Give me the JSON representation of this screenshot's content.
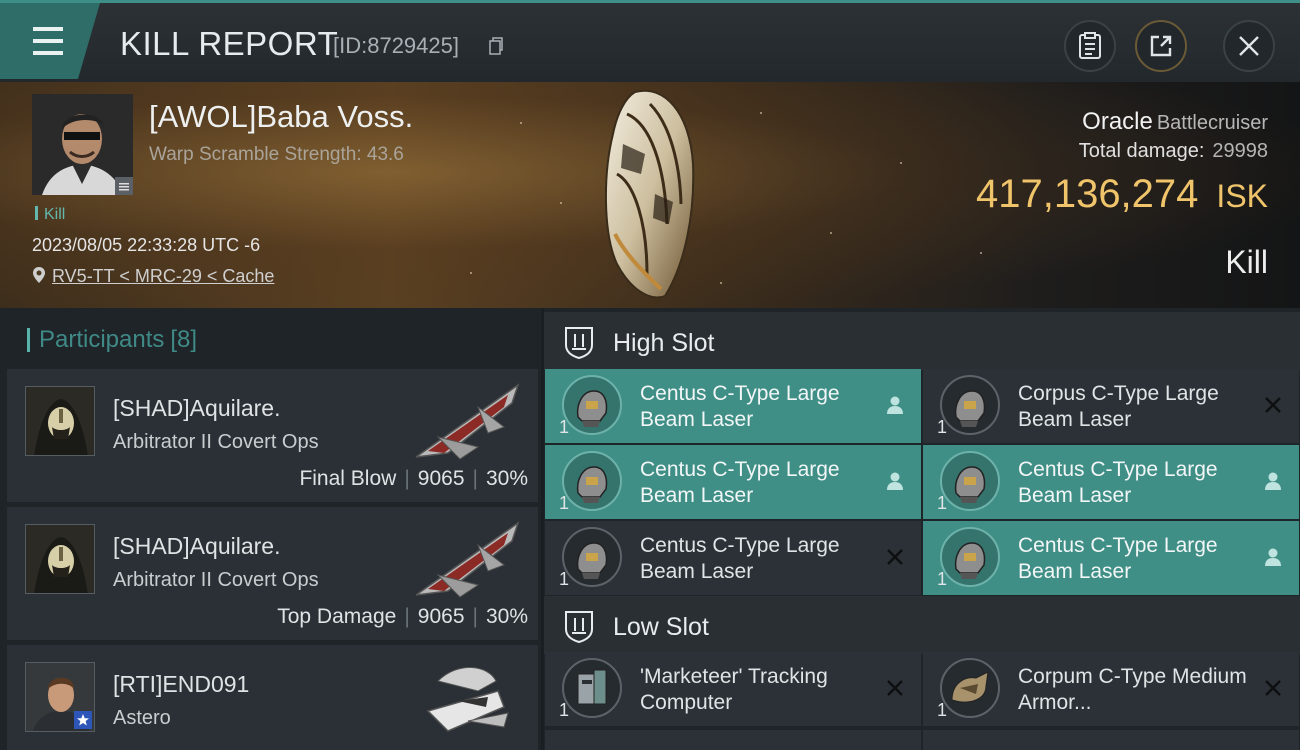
{
  "header": {
    "title": "KILL REPORT",
    "report_id": "[ID:8729425]"
  },
  "victim": {
    "name": "[AWOL]Baba Voss.",
    "warp_scramble": "Warp Scramble Strength: 43.6",
    "kill_tag": "Kill",
    "timestamp": "2023/08/05 22:33:28 UTC -6",
    "location": "RV5-TT < MRC-29 < Cache"
  },
  "ship": {
    "name": "Oracle",
    "class": "Battlecruiser",
    "total_damage_label": "Total damage:",
    "total_damage": "29998",
    "isk_value": "417,136,274",
    "isk_unit": "ISK",
    "result": "Kill"
  },
  "participants": {
    "label": "Participants",
    "count": "[8]",
    "items": [
      {
        "name": "[SHAD]Aquilare.",
        "ship": "Arbitrator II Covert Ops",
        "role": "Final Blow",
        "damage": "9065",
        "percent": "30%"
      },
      {
        "name": "[SHAD]Aquilare.",
        "ship": "Arbitrator II Covert Ops",
        "role": "Top Damage",
        "damage": "9065",
        "percent": "30%"
      },
      {
        "name": "[RTI]END091",
        "ship": "Astero"
      }
    ]
  },
  "high_slot": {
    "label": "High Slot",
    "modules": [
      {
        "name": "Centus C-Type Large Beam Laser",
        "qty": "1"
      },
      {
        "name": "Corpus C-Type Large Beam Laser",
        "qty": "1"
      },
      {
        "name": "Centus C-Type Large Beam Laser",
        "qty": "1"
      },
      {
        "name": "Centus C-Type Large Beam Laser",
        "qty": "1"
      },
      {
        "name": "Centus C-Type Large Beam Laser",
        "qty": "1"
      },
      {
        "name": "Centus C-Type Large Beam Laser",
        "qty": "1"
      }
    ]
  },
  "low_slot": {
    "label": "Low Slot",
    "modules": [
      {
        "name": "'Marketeer' Tracking Computer",
        "qty": "1"
      },
      {
        "name": "Corpum C-Type Medium Armor...",
        "qty": "1"
      }
    ]
  },
  "colors": {
    "accent": "#3f8f87",
    "isk": "#f0c46b"
  }
}
